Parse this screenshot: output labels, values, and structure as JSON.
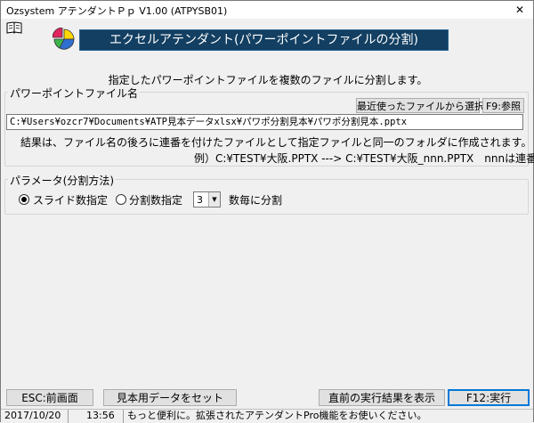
{
  "window": {
    "title": "Ozsystem アテンダントＰｐ V1.00 (ATPYSB01)",
    "close_label": "✕"
  },
  "banner": {
    "title": "エクセルアテンダント(パワーポイントファイルの分割)"
  },
  "instruction": "指定したパワーポイントファイルを複数のファイルに分割します。",
  "file_group": {
    "legend": "パワーポイントファイル名",
    "recent_button": "最近使ったファイルから選択",
    "browse_button": "F9:参照",
    "path_value": "C:¥Users¥ozcr7¥Documents¥ATP見本データxlsx¥パワポ分割見本¥パワポ分割見本.pptx",
    "note": "結果は、ファイル名の後ろに連番を付けたファイルとして指定ファイルと同一のフォルダに作成されます。",
    "example": "例）C:¥TEST¥大阪.PPTX ---> C:¥TEST¥大阪_nnn.PPTX　nnnは連番)"
  },
  "param_group": {
    "legend": "パラメータ(分割方法)",
    "option_slide": "スライド数指定",
    "option_split": "分割数指定",
    "selected_option": "スライド数指定",
    "count_value": "3",
    "count_suffix": "数毎に分割"
  },
  "footer": {
    "esc_button": "ESC:前画面",
    "sample_button": "見本用データをセット",
    "last_result_button": "直前の実行結果を表示",
    "execute_button": "F12:実行"
  },
  "status": {
    "date": "2017/10/20",
    "time": "13:56",
    "message": "もっと便利に。拡張されたアテンダントPro機能をお使いください。"
  }
}
